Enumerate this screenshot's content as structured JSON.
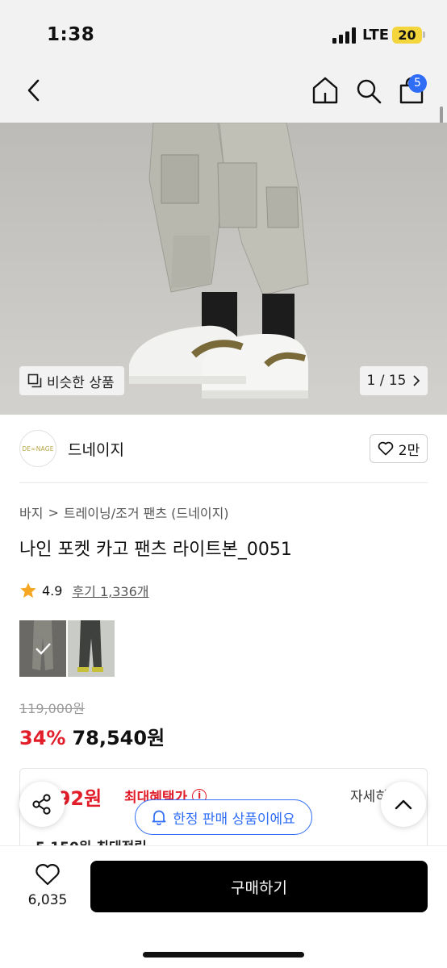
{
  "status_bar": {
    "time": "1:38",
    "network": "LTE",
    "battery": "20"
  },
  "nav": {
    "cart_count": "5",
    "icons": [
      "back-arrow-icon",
      "home-icon",
      "search-icon",
      "shopping-bag-icon"
    ]
  },
  "hero": {
    "similar_label": "비슷한 상품",
    "page_indicator": "1 / 15"
  },
  "brand": {
    "logo_text": "DE∞NAGE",
    "name": "드네이지",
    "like_count": "2만"
  },
  "breadcrumb": {
    "category": "바지",
    "separator": ">",
    "subcategory": "트레이닝/조거 팬츠 (드네이지)"
  },
  "product": {
    "title": "나인 포켓 카고 팬츠 라이트본_0051",
    "rating": "4.9",
    "reviews": "후기 1,336개"
  },
  "price": {
    "original": "119,000원",
    "discount": "34%",
    "sale": "78,540원"
  },
  "benefit": {
    "price_fragment": "392원",
    "label": "최대혜택가",
    "info_icon": "i",
    "detail": "자세히",
    "points": "5,150원 최대적립"
  },
  "floating": {
    "limited_label": "한정 판매 상품이에요"
  },
  "bottom": {
    "wish_count": "6,035",
    "buy_label": "구매하기"
  },
  "colors": {
    "accent_red": "#e11d2a",
    "accent_blue": "#2f6df6"
  }
}
